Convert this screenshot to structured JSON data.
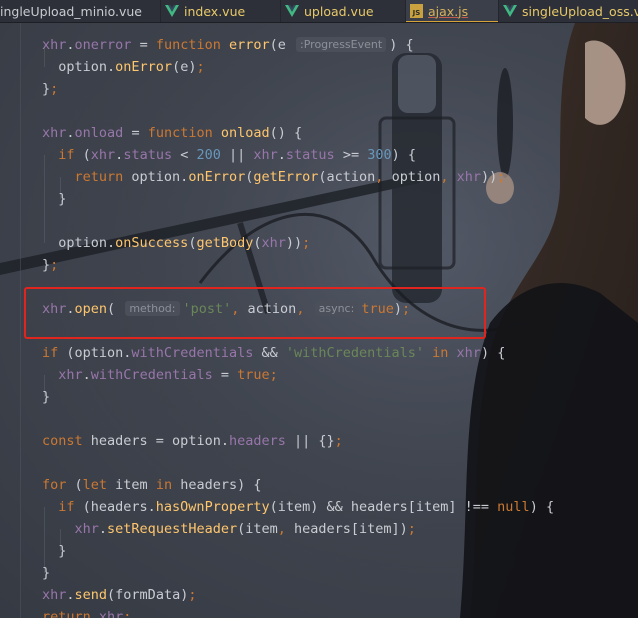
{
  "tabs": [
    {
      "label": "ingleUpload_minio.vue",
      "icon": "vue-icon",
      "kind": "vue"
    },
    {
      "label": "index.vue",
      "icon": "vue-icon",
      "kind": "vue"
    },
    {
      "label": "upload.vue",
      "icon": "vue-icon",
      "kind": "vue"
    },
    {
      "label": "ajax.js",
      "icon": "js-icon",
      "kind": "js",
      "active": true
    },
    {
      "label": "singleUpload_oss.vue",
      "icon": "vue-icon",
      "kind": "vue"
    }
  ],
  "js_badge": "JS",
  "code_lines": [
    [
      [
        "var",
        "xhr"
      ],
      [
        "tx",
        "."
      ],
      [
        "var",
        "onerror"
      ],
      [
        "tx",
        " = "
      ],
      [
        "kw",
        "function "
      ],
      [
        "fn",
        "error"
      ],
      [
        "tx",
        "(e "
      ],
      [
        "hint",
        ":ProgressEvent"
      ],
      [
        "tx",
        ") {"
      ]
    ],
    [
      [
        "tx",
        "  option."
      ],
      [
        "fn",
        "onError"
      ],
      [
        "tx",
        "(e)"
      ],
      [
        "kw",
        ";"
      ]
    ],
    [
      [
        "tx",
        "}"
      ],
      [
        "kw",
        ";"
      ]
    ],
    [],
    [
      [
        "var",
        "xhr"
      ],
      [
        "tx",
        "."
      ],
      [
        "var",
        "onload"
      ],
      [
        "tx",
        " = "
      ],
      [
        "kw",
        "function "
      ],
      [
        "fn",
        "onload"
      ],
      [
        "tx",
        "() {"
      ]
    ],
    [
      [
        "kw",
        "  if "
      ],
      [
        "tx",
        "("
      ],
      [
        "var",
        "xhr"
      ],
      [
        "tx",
        "."
      ],
      [
        "var",
        "status"
      ],
      [
        "tx",
        " < "
      ],
      [
        "num",
        "200"
      ],
      [
        "tx",
        " || "
      ],
      [
        "var",
        "xhr"
      ],
      [
        "tx",
        "."
      ],
      [
        "var",
        "status"
      ],
      [
        "tx",
        " >= "
      ],
      [
        "num",
        "300"
      ],
      [
        "tx",
        ") {"
      ]
    ],
    [
      [
        "kw",
        "    return "
      ],
      [
        "tx",
        "option."
      ],
      [
        "fn",
        "onError"
      ],
      [
        "tx",
        "("
      ],
      [
        "fn",
        "getError"
      ],
      [
        "tx",
        "(action"
      ],
      [
        "kw",
        ", "
      ],
      [
        "tx",
        "option"
      ],
      [
        "kw",
        ", "
      ],
      [
        "var",
        "xhr"
      ],
      [
        "tx",
        "))"
      ],
      [
        "kw",
        ";"
      ]
    ],
    [
      [
        "tx",
        "  }"
      ]
    ],
    [],
    [
      [
        "tx",
        "  option."
      ],
      [
        "fn",
        "onSuccess"
      ],
      [
        "tx",
        "("
      ],
      [
        "fn",
        "getBody"
      ],
      [
        "tx",
        "("
      ],
      [
        "var",
        "xhr"
      ],
      [
        "tx",
        "))"
      ],
      [
        "kw",
        ";"
      ]
    ],
    [
      [
        "tx",
        "}"
      ],
      [
        "kw",
        ";"
      ]
    ],
    [],
    [
      [
        "var",
        "xhr"
      ],
      [
        "tx",
        "."
      ],
      [
        "fn",
        "open"
      ],
      [
        "tx",
        "( "
      ],
      [
        "hint",
        "method:"
      ],
      [
        "str",
        "'post'"
      ],
      [
        "kw",
        ", "
      ],
      [
        "tx",
        "action"
      ],
      [
        "kw",
        ", "
      ],
      [
        "hint",
        "async:"
      ],
      [
        "kw",
        "true"
      ],
      [
        "tx",
        ")"
      ],
      [
        "kw",
        ";"
      ]
    ],
    [],
    [
      [
        "kw",
        "if "
      ],
      [
        "tx",
        "(option."
      ],
      [
        "var",
        "withCredentials"
      ],
      [
        "tx",
        " && "
      ],
      [
        "str",
        "'withCredentials'"
      ],
      [
        "kw",
        " in "
      ],
      [
        "var",
        "xhr"
      ],
      [
        "tx",
        ") {"
      ]
    ],
    [
      [
        "tx",
        "  "
      ],
      [
        "var",
        "xhr"
      ],
      [
        "tx",
        "."
      ],
      [
        "var",
        "withCredentials"
      ],
      [
        "tx",
        " = "
      ],
      [
        "kw",
        "true;"
      ]
    ],
    [
      [
        "tx",
        "}"
      ]
    ],
    [],
    [
      [
        "kw",
        "const "
      ],
      [
        "tx",
        "headers = option."
      ],
      [
        "var",
        "headers"
      ],
      [
        "tx",
        " || {}"
      ],
      [
        "kw",
        ";"
      ]
    ],
    [],
    [
      [
        "kw",
        "for "
      ],
      [
        "tx",
        "("
      ],
      [
        "kw",
        "let "
      ],
      [
        "tx",
        "item "
      ],
      [
        "kw",
        "in "
      ],
      [
        "tx",
        "headers) {"
      ]
    ],
    [
      [
        "kw",
        "  if "
      ],
      [
        "tx",
        "(headers."
      ],
      [
        "fn",
        "hasOwnProperty"
      ],
      [
        "tx",
        "(item) && headers[item] !== "
      ],
      [
        "kw",
        "null"
      ],
      [
        "tx",
        ") {"
      ]
    ],
    [
      [
        "tx",
        "    "
      ],
      [
        "var",
        "xhr"
      ],
      [
        "tx",
        "."
      ],
      [
        "fn",
        "setRequestHeader"
      ],
      [
        "tx",
        "(item"
      ],
      [
        "kw",
        ", "
      ],
      [
        "tx",
        "headers[item])"
      ],
      [
        "kw",
        ";"
      ]
    ],
    [
      [
        "tx",
        "  }"
      ]
    ],
    [
      [
        "tx",
        "}"
      ]
    ],
    [
      [
        "var",
        "xhr"
      ],
      [
        "tx",
        "."
      ],
      [
        "fn",
        "send"
      ],
      [
        "tx",
        "(formData)"
      ],
      [
        "kw",
        ";"
      ]
    ],
    [
      [
        "kw",
        "return "
      ],
      [
        "var",
        "xhr"
      ],
      [
        "kw",
        ";"
      ]
    ]
  ]
}
